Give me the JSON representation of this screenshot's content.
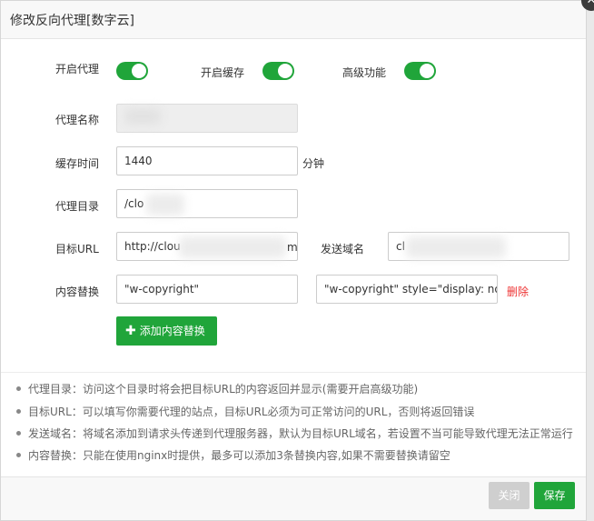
{
  "dialog": {
    "title": "修改反向代理[数字云]"
  },
  "toggles": [
    {
      "label": "开启代理",
      "on": true
    },
    {
      "label": "开启缓存",
      "on": true
    },
    {
      "label": "高级功能",
      "on": true
    }
  ],
  "form": {
    "proxy_name_label": "代理名称",
    "proxy_name_value": "",
    "cache_time_label": "缓存时间",
    "cache_time_value": "1440",
    "cache_time_unit": "分钟",
    "proxy_dir_label": "代理目录",
    "proxy_dir_value": "/clo",
    "target_url_label": "目标URL",
    "target_url_value": "http://clou",
    "target_url_tail": "m",
    "send_domain_label": "发送域名",
    "send_domain_value": "cl",
    "content_replace_label": "内容替换",
    "replace_from": "\"w-copyright\"",
    "replace_to": "\"w-copyright\" style=\"display: non",
    "delete_label": "删除",
    "add_replace_button": "添加内容替换"
  },
  "notes": [
    "代理目录：访问这个目录时将会把目标URL的内容返回并显示(需要开启高级功能)",
    "目标URL：可以填写你需要代理的站点，目标URL必须为可正常访问的URL，否则将返回错误",
    "发送域名：将域名添加到请求头传递到代理服务器，默认为目标URL域名，若设置不当可能导致代理无法正常运行",
    "内容替换：只能在使用nginx时提供，最多可以添加3条替换内容,如果不需要替换请留空"
  ],
  "footer": {
    "close_button": "关闭",
    "save_button": "保存"
  },
  "colors": {
    "accent": "#20a53a",
    "danger": "#ee3333"
  },
  "icons": {
    "close": "close-icon",
    "add": "plus-icon"
  }
}
